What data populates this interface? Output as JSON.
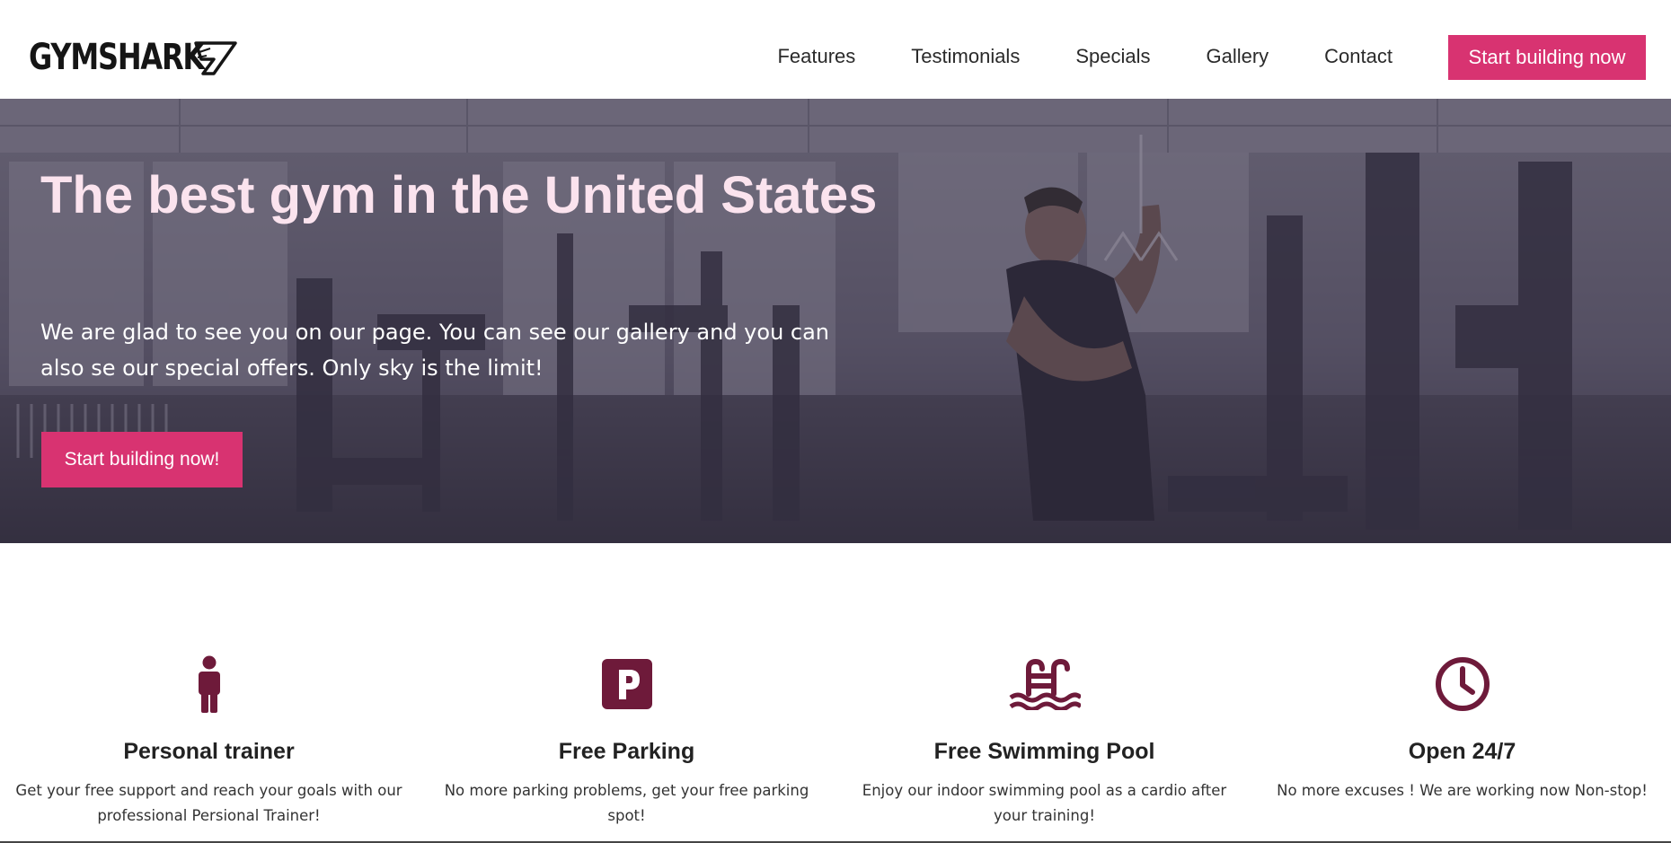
{
  "brand": {
    "name": "GYMSHARK",
    "accent_color": "#d83371",
    "icon_color": "#6e1a3a"
  },
  "nav": {
    "links": [
      "Features",
      "Testimonials",
      "Specials",
      "Gallery",
      "Contact"
    ],
    "cta_label": "Start building now"
  },
  "hero": {
    "title": "The best gym in the United States",
    "text": "We are glad to see you on our page. You can see our gallery and you can also se our special offers. Only sky is the limit!",
    "cta_label": "Start building now!"
  },
  "features": [
    {
      "icon": "person-icon",
      "title": "Personal trainer",
      "text": "Get your free support and reach your goals with our professional Persional Trainer!"
    },
    {
      "icon": "parking-icon",
      "title": "Free Parking",
      "text": "No more parking problems, get your free parking spot!"
    },
    {
      "icon": "swimming-pool-icon",
      "title": "Free Swimming Pool",
      "text": "Enjoy our indoor swimming pool as a cardio after your training!"
    },
    {
      "icon": "clock-icon",
      "title": "Open 24/7",
      "text": "No more excuses ! We are working now Non-stop!"
    }
  ]
}
